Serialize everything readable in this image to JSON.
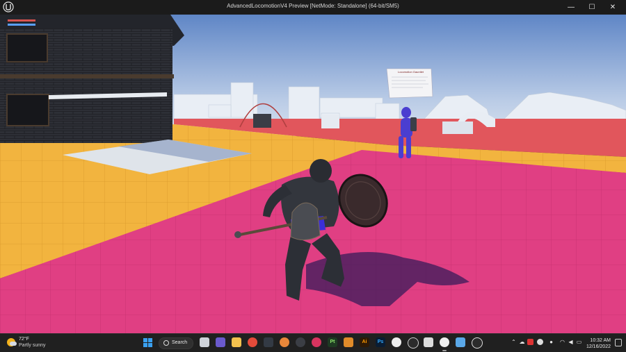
{
  "window": {
    "title": "AdvancedLocomotionV4 Preview [NetMode: Standalone]  (64-bit/SM5)",
    "controls": {
      "minimize": "—",
      "maximize": "☐",
      "close": "✕"
    }
  },
  "hud": {
    "health_color": "#d9534f",
    "stamina_color": "#5aa0ff"
  },
  "scene": {
    "sign_title": "Locomotion Gauntlet"
  },
  "taskbar": {
    "weather": {
      "temp": "72°F",
      "condition": "Partly sunny",
      "icon": "partly-sunny-icon"
    },
    "search_label": "Search",
    "apps": [
      {
        "name": "start-button",
        "label": ""
      },
      {
        "name": "task-view-icon",
        "label": ""
      },
      {
        "name": "teams-icon",
        "label": ""
      },
      {
        "name": "file-explorer-icon",
        "label": ""
      },
      {
        "name": "chrome-icon",
        "label": ""
      },
      {
        "name": "blender-icon",
        "label": ""
      },
      {
        "name": "unreal-launcher-icon",
        "label": ""
      },
      {
        "name": "davinci-icon",
        "label": ""
      },
      {
        "name": "app-red-icon",
        "label": ""
      },
      {
        "name": "pt-icon",
        "label": "Pt"
      },
      {
        "name": "box-icon",
        "label": ""
      },
      {
        "name": "illustrator-icon",
        "label": "Ai"
      },
      {
        "name": "photoshop-icon",
        "label": "Ps"
      },
      {
        "name": "inkscape-icon",
        "label": ""
      },
      {
        "name": "obs-icon",
        "label": ""
      },
      {
        "name": "capture-icon",
        "label": ""
      },
      {
        "name": "unreal-editor-icon",
        "label": ""
      },
      {
        "name": "notepad-icon",
        "label": ""
      },
      {
        "name": "app-ring-icon",
        "label": ""
      }
    ],
    "clock": {
      "time": "10:32 AM",
      "date": "12/16/2022"
    }
  }
}
